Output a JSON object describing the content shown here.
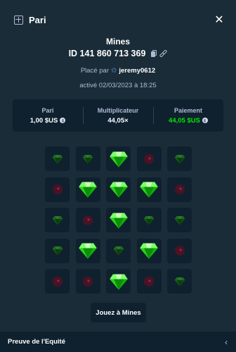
{
  "header": {
    "title": "Pari",
    "icon": "bet-slip-icon",
    "close_icon": "close-icon",
    "close_glyph": "✕"
  },
  "bet": {
    "game": "Mines",
    "id_text": "ID 141 860 713 369",
    "placed_by_prefix": "Placé par",
    "user": "jeremy0612",
    "date_text": "activé 02/03/2023 à 18:25"
  },
  "stats": {
    "bet_label": "Pari",
    "bet_value": "1,00 $US",
    "multiplier_label": "Multiplicateur",
    "multiplier_value": "44,05×",
    "payout_label": "Paiement",
    "payout_value": "44,05 $US"
  },
  "board": {
    "rows": 5,
    "cols": 5,
    "tiles": [
      "gem-unrevealed",
      "gem-unrevealed",
      "gem-revealed",
      "mine-unrevealed",
      "gem-unrevealed",
      "mine-unrevealed",
      "gem-revealed",
      "gem-revealed",
      "gem-revealed",
      "mine-unrevealed",
      "gem-unrevealed",
      "mine-unrevealed",
      "gem-revealed",
      "gem-unrevealed",
      "gem-unrevealed",
      "gem-unrevealed",
      "gem-revealed",
      "gem-unrevealed",
      "gem-revealed",
      "mine-unrevealed",
      "mine-unrevealed",
      "mine-unrevealed",
      "gem-revealed",
      "mine-unrevealed",
      "gem-unrevealed"
    ]
  },
  "actions": {
    "play_label": "Jouez à Mines"
  },
  "footer": {
    "label": "Preuve de l'Equité",
    "chevron": "‹"
  },
  "colors": {
    "background": "#1a2c38",
    "panel": "#0f212e",
    "accent_green": "#00e701",
    "muted_text": "#b1bad3",
    "mine_dark": "#4a1225"
  }
}
